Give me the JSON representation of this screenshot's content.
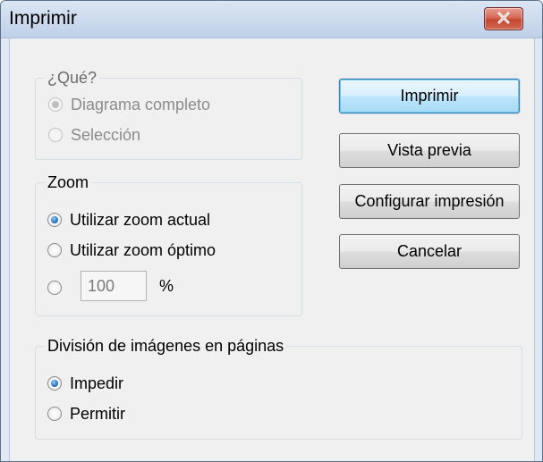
{
  "window": {
    "title": "Imprimir"
  },
  "what_group": {
    "legend": "¿Qué?",
    "options": [
      {
        "label": "Diagrama completo",
        "checked": true,
        "enabled": false
      },
      {
        "label": "Selección",
        "checked": false,
        "enabled": false
      }
    ]
  },
  "zoom_group": {
    "legend": "Zoom",
    "options": [
      {
        "label": "Utilizar zoom actual",
        "checked": true,
        "enabled": true
      },
      {
        "label": "Utilizar zoom óptimo",
        "checked": false,
        "enabled": true
      },
      {
        "label": "",
        "checked": false,
        "enabled": true
      }
    ],
    "custom_zoom_value": "100",
    "percent_label": "%"
  },
  "split_group": {
    "legend": "División de imágenes en páginas",
    "options": [
      {
        "label": "Impedir",
        "checked": true,
        "enabled": true
      },
      {
        "label": "Permitir",
        "checked": false,
        "enabled": true
      }
    ]
  },
  "buttons": {
    "print": "Imprimir",
    "preview": "Vista previa",
    "setup": "Configurar impresión",
    "cancel": "Cancelar"
  },
  "icons": {
    "close": "close-icon"
  },
  "colors": {
    "accent": "#3c7fb1",
    "close_red": "#c44732",
    "window_frame": "#dfe9f5"
  }
}
